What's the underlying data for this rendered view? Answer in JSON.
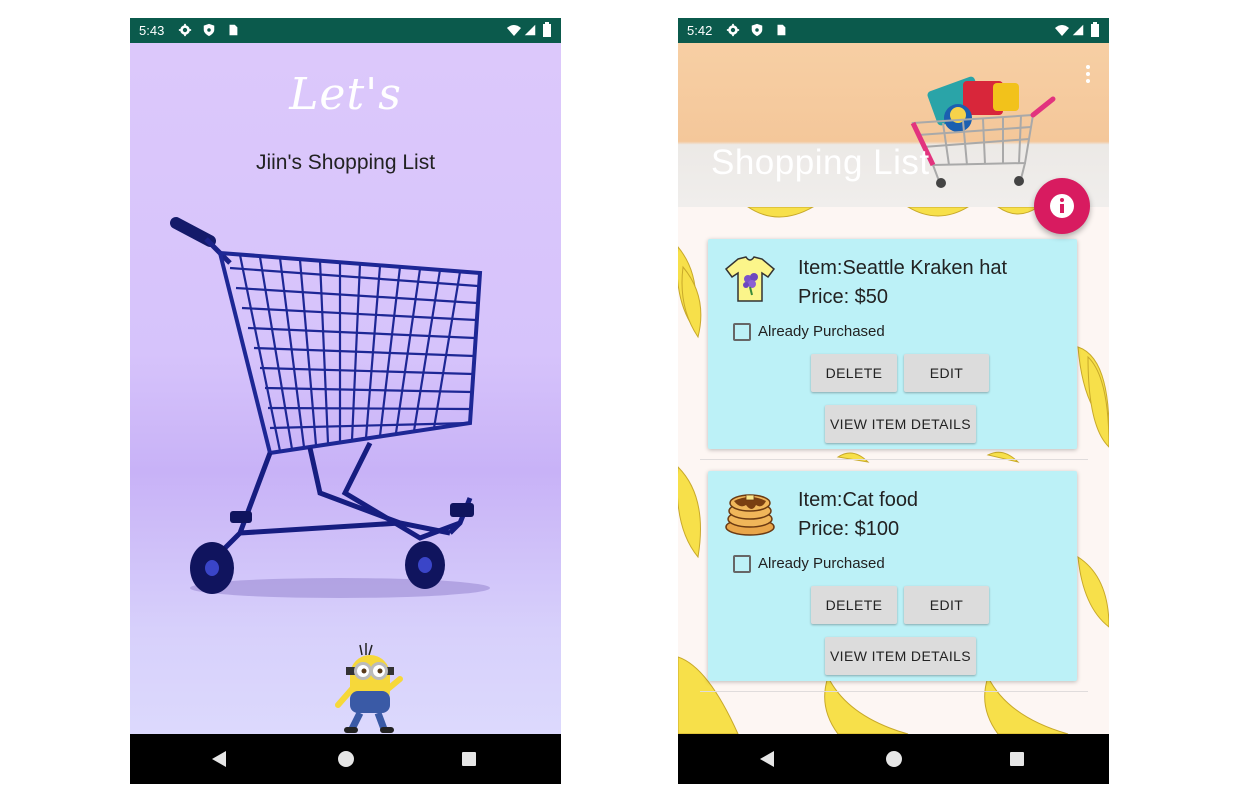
{
  "left_screen": {
    "status_time": "5:43",
    "lets_text": "Let's",
    "title": "Jiin's Shopping List"
  },
  "right_screen": {
    "status_time": "5:42",
    "header_title": "Shopping List",
    "items": [
      {
        "name": "Item:Seattle Kraken hat",
        "price": "Price: $50",
        "purchased_label": "Already Purchased",
        "purchased": false,
        "icon": "tshirt-icon",
        "delete_label": "DELETE",
        "edit_label": "EDIT",
        "view_label": "VIEW ITEM DETAILS"
      },
      {
        "name": "Item:Cat food",
        "price": "Price: $100",
        "purchased_label": "Already Purchased",
        "purchased": false,
        "icon": "pancakes-icon",
        "delete_label": "DELETE",
        "edit_label": "EDIT",
        "view_label": "VIEW ITEM DETAILS"
      }
    ]
  },
  "colors": {
    "status_bar": "#0b5a4c",
    "card": "#bcf1f7",
    "fab": "#d81b60",
    "splash_bg": "#d6c3fb"
  }
}
